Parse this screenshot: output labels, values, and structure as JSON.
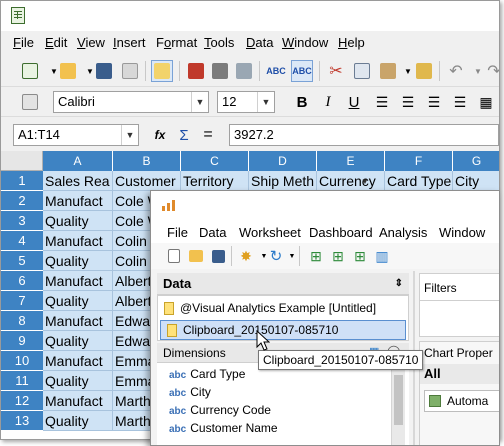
{
  "calc": {
    "menu": [
      "File",
      "Edit",
      "View",
      "Insert",
      "Format",
      "Tools",
      "Data",
      "Window",
      "Help"
    ],
    "menu_underlines": [
      "F",
      "E",
      "V",
      "I",
      "o",
      "T",
      "D",
      "W",
      "H"
    ],
    "font_name": "Calibri",
    "font_size": "12",
    "name_box": "A1:T14",
    "formula_value": "3927.2",
    "columns": [
      "A",
      "B",
      "C",
      "D",
      "E",
      "F",
      "G"
    ],
    "rows": [
      "1",
      "2",
      "3",
      "4",
      "5",
      "6",
      "7",
      "8",
      "9",
      "10",
      "11",
      "12",
      "13"
    ],
    "cells_a": [
      "Sales Rea",
      "Manufact",
      "Quality",
      "Manufact",
      "Quality",
      "Manufact",
      "Quality",
      "Manufact",
      "Quality",
      "Manufact",
      "Quality",
      "Manufact",
      "Quality"
    ],
    "cells_b": [
      "Customer",
      "Cole W",
      "Cole W",
      "Colin A",
      "Colin A",
      "Albert",
      "Albert",
      "Edwar",
      "Edwar",
      "Emma",
      "Emma",
      "Marth",
      "Marth"
    ],
    "header_row": [
      "Territory",
      "Ship Meth",
      "Currency",
      "Card Type",
      "City"
    ]
  },
  "va": {
    "menu": [
      "File",
      "Data",
      "Worksheet",
      "Dashboard",
      "Analysis",
      "Window"
    ],
    "data_panel_title": "Data",
    "datasources": [
      "@Visual Analytics Example [Untitled]",
      "Clipboard_20150107-085710"
    ],
    "dimensions_title": "Dimensions",
    "dimensions": [
      "Card Type",
      "City",
      "Currency Code",
      "Customer Name"
    ],
    "dim_type": "abc",
    "filters_title": "Filters",
    "chart_props_title": "Chart Proper",
    "chart_props_scope": "All",
    "automatic_label": "Automa",
    "tooltip": "Clipboard_20150107-085710"
  },
  "colors": {
    "header_blue": "#3e83c3",
    "selected_cell": "#cfe3f5",
    "datasource_selected": "#cfe0f7"
  }
}
